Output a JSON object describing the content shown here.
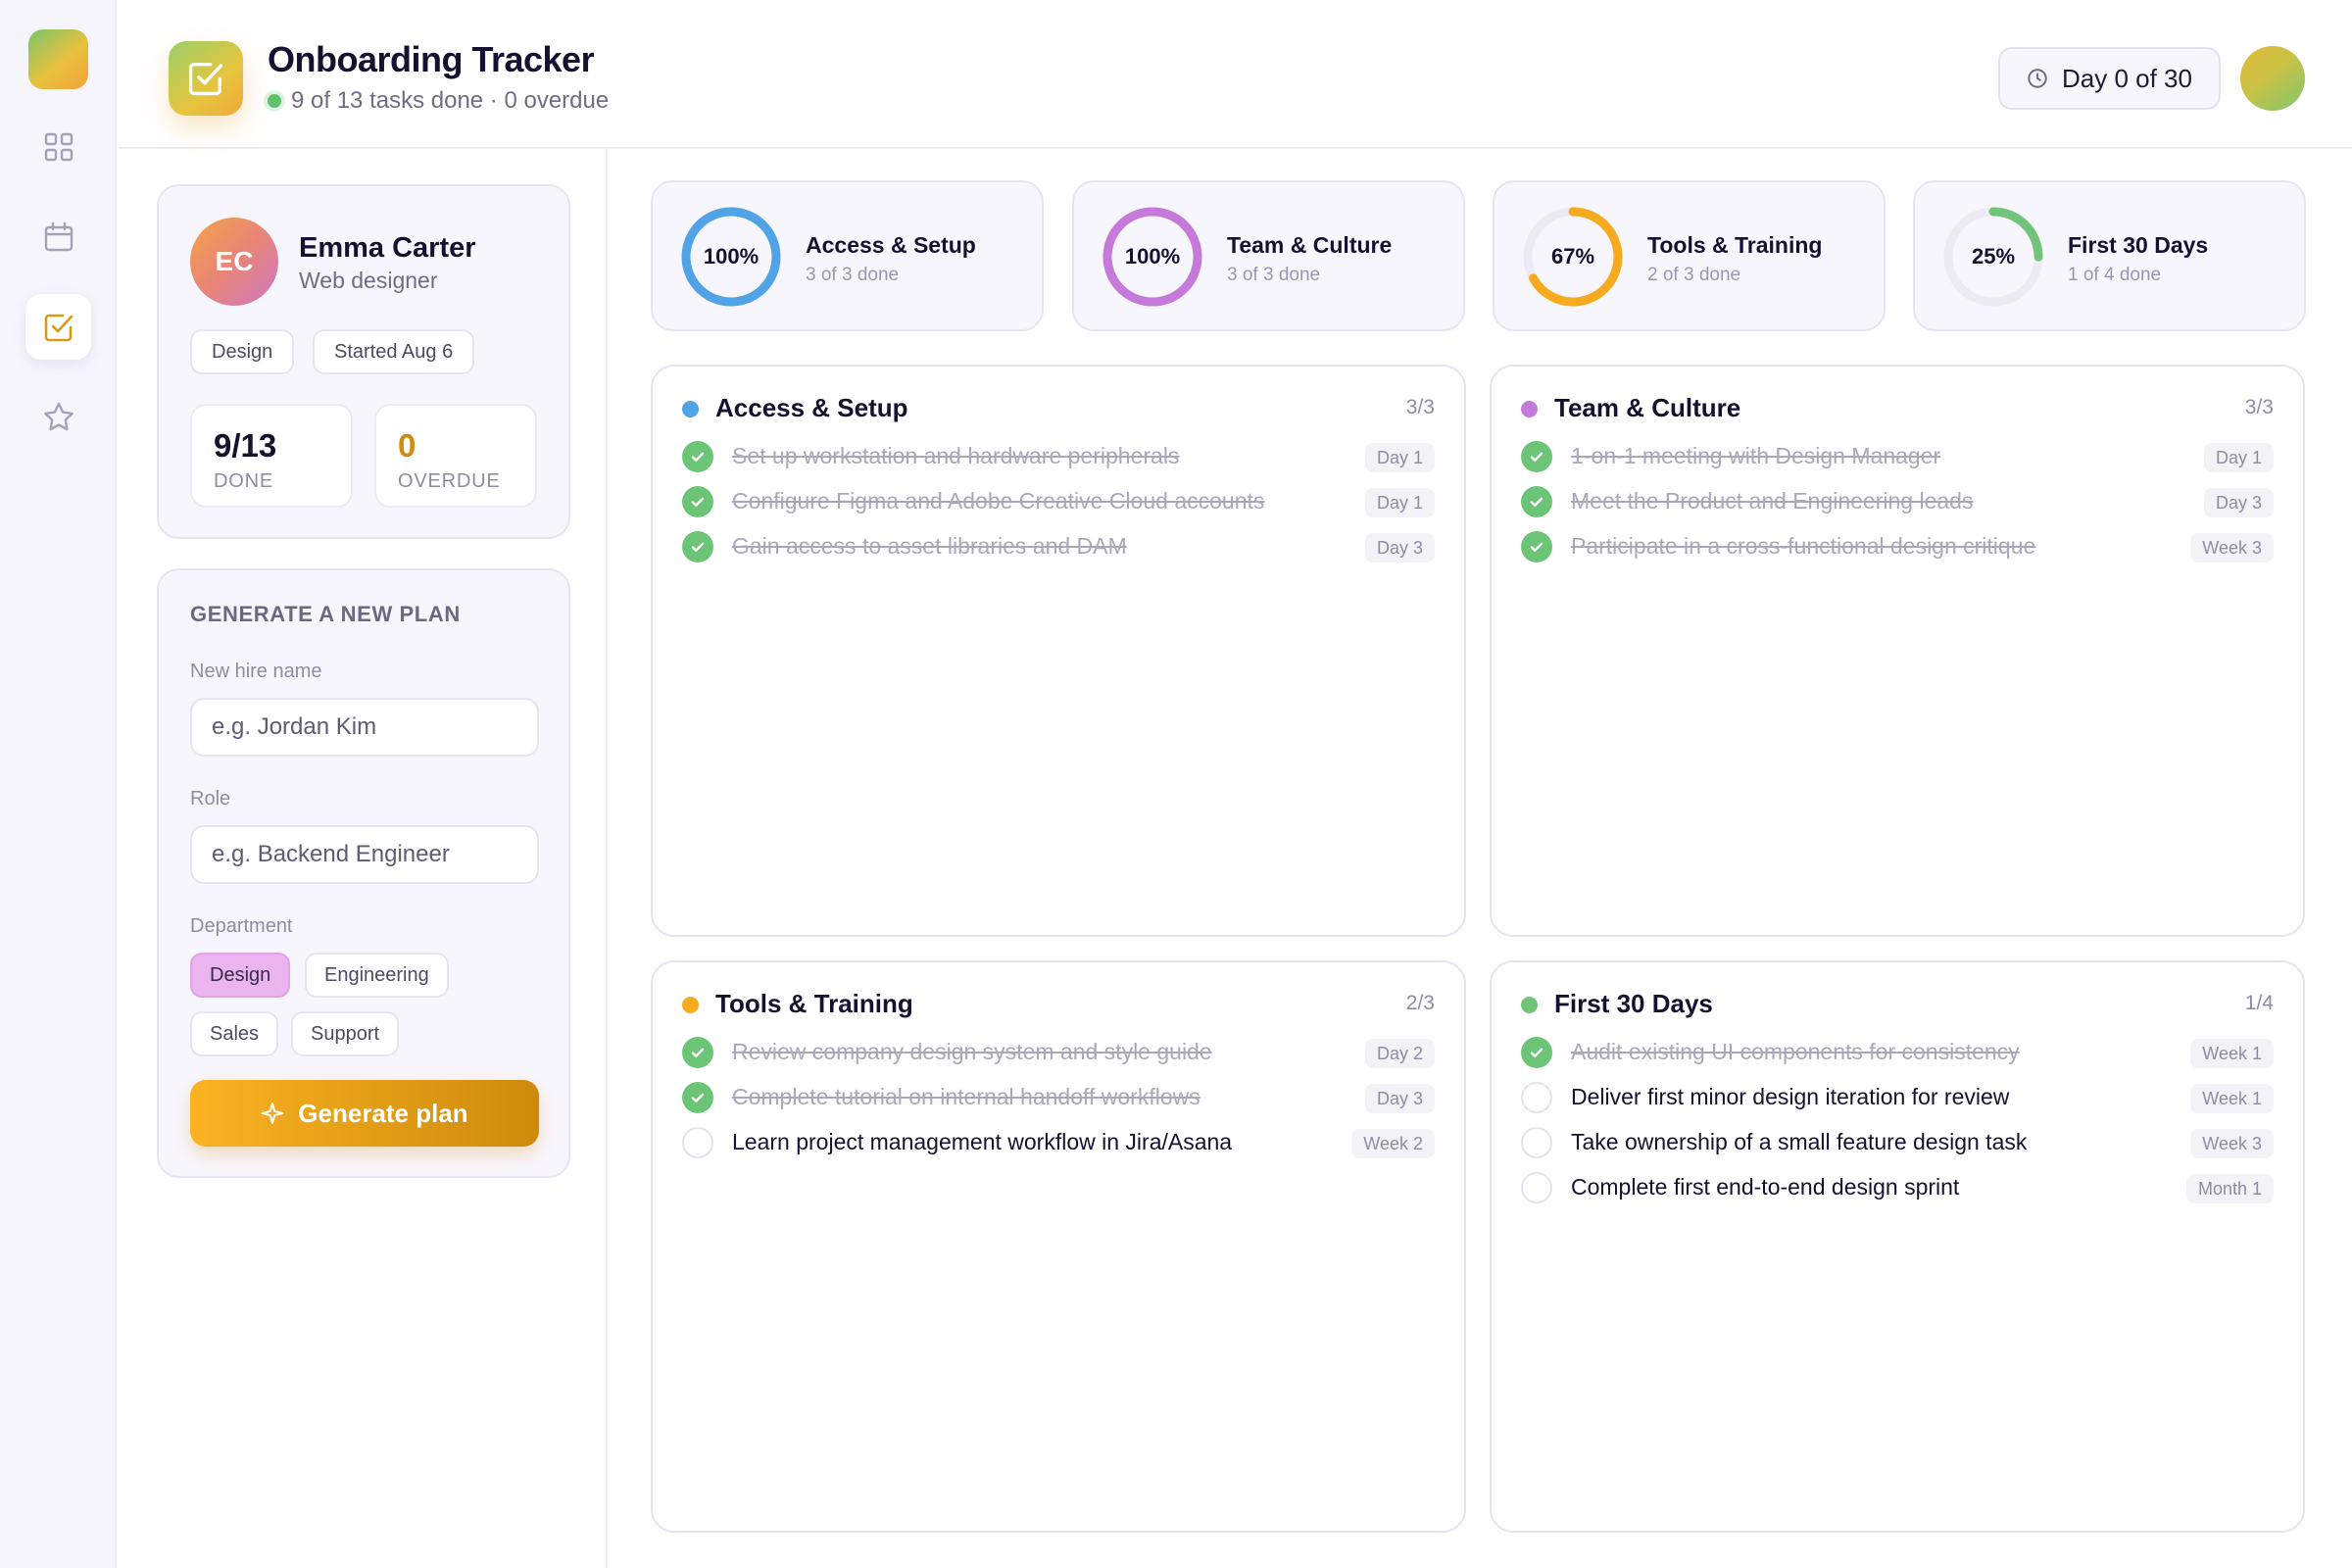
{
  "app": {
    "title": "Onboarding Tracker",
    "subtitle": "9 of 13 tasks done · 0 overdue",
    "day_label": "Day 0 of 30"
  },
  "rail": {
    "items": [
      {
        "icon": "grid-icon"
      },
      {
        "icon": "calendar-icon"
      },
      {
        "icon": "checkbox-icon",
        "active": true
      },
      {
        "icon": "star-icon"
      }
    ]
  },
  "profile": {
    "initials": "EC",
    "name": "Emma Carter",
    "role": "Web designer",
    "chips": [
      "Design",
      "Started Aug 6"
    ],
    "stats": [
      {
        "value": "9/13",
        "label": "DONE",
        "color": "#141230"
      },
      {
        "value": "0",
        "label": "OVERDUE",
        "color": "#d18a10"
      }
    ]
  },
  "plan": {
    "title": "GENERATE A NEW PLAN",
    "name_label": "New hire name",
    "name_placeholder": "e.g. Jordan Kim",
    "role_label": "Role",
    "role_placeholder": "e.g. Backend Engineer",
    "dept_label": "Department",
    "departments": [
      "Design",
      "Engineering",
      "Sales",
      "Support"
    ],
    "selected_department": "Design",
    "button_label": "Generate plan"
  },
  "summary": [
    {
      "name": "Access & Setup",
      "pct_label": "100%",
      "fraction": 1.0,
      "sub": "3 of 3 done",
      "color": "#4fa3e6"
    },
    {
      "name": "Team & Culture",
      "pct_label": "100%",
      "fraction": 1.0,
      "sub": "3 of 3 done",
      "color": "#c57ad9"
    },
    {
      "name": "Tools & Training",
      "pct_label": "67%",
      "fraction": 0.67,
      "sub": "2 of 3 done",
      "color": "#f6ab1e"
    },
    {
      "name": "First 30 Days",
      "pct_label": "25%",
      "fraction": 0.25,
      "sub": "1 of 4 done",
      "color": "#72c47a"
    }
  ],
  "categories": [
    {
      "title": "Access & Setup",
      "count": "3/3",
      "color": "#4fa3e6",
      "tasks": [
        {
          "text": "Set up workstation and hardware peripherals",
          "tag": "Day 1",
          "done": true
        },
        {
          "text": "Configure Figma and Adobe Creative Cloud accounts",
          "tag": "Day 1",
          "done": true
        },
        {
          "text": "Gain access to asset libraries and DAM",
          "tag": "Day 3",
          "done": true
        }
      ]
    },
    {
      "title": "Team & Culture",
      "count": "3/3",
      "color": "#c57ad9",
      "tasks": [
        {
          "text": "1-on-1 meeting with Design Manager",
          "tag": "Day 1",
          "done": true
        },
        {
          "text": "Meet the Product and Engineering leads",
          "tag": "Day 3",
          "done": true
        },
        {
          "text": "Participate in a cross-functional design critique",
          "tag": "Week 3",
          "done": true
        }
      ]
    },
    {
      "title": "Tools & Training",
      "count": "2/3",
      "color": "#f6ab1e",
      "tasks": [
        {
          "text": "Review company design system and style guide",
          "tag": "Day 2",
          "done": true
        },
        {
          "text": "Complete tutorial on internal handoff workflows",
          "tag": "Day 3",
          "done": true
        },
        {
          "text": "Learn project management workflow in Jira/Asana",
          "tag": "Week 2",
          "done": false
        }
      ]
    },
    {
      "title": "First 30 Days",
      "count": "1/4",
      "color": "#72c47a",
      "tasks": [
        {
          "text": "Audit existing UI components for consistency",
          "tag": "Week 1",
          "done": true
        },
        {
          "text": "Deliver first minor design iteration for review",
          "tag": "Week 1",
          "done": false
        },
        {
          "text": "Take ownership of a small feature design task",
          "tag": "Week 3",
          "done": false
        },
        {
          "text": "Complete first end-to-end design sprint",
          "tag": "Month 1",
          "done": false
        }
      ]
    }
  ]
}
